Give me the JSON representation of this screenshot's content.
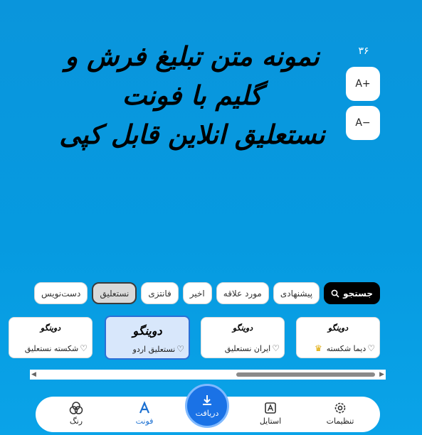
{
  "font_size": "۳۶",
  "size_buttons": {
    "increase": "A+",
    "decrease": "A−"
  },
  "preview": {
    "line1": "نمونه متن تبلیغ فرش و گلیم با فونت",
    "line2": "نستعلیق انلاین قابل کپی"
  },
  "filters": [
    {
      "label": "جستجو",
      "icon": "search-icon",
      "style": "search"
    },
    {
      "label": "پیشنهادی"
    },
    {
      "label": "مورد علاقه"
    },
    {
      "label": "اخیر"
    },
    {
      "label": "فانتزی"
    },
    {
      "label": "نستعلیق",
      "state": "active"
    },
    {
      "label": "دست‌نویس"
    }
  ],
  "font_cards": [
    {
      "glyph": "دوینگو",
      "name": "دیما شکسته",
      "badge": "crown-icon"
    },
    {
      "glyph": "دوینگو",
      "name": "ایران نستعلیق"
    },
    {
      "glyph": "دوینگو",
      "name": "نستعلیق اردو",
      "state": "selected"
    },
    {
      "glyph": "دوینگو",
      "name": "شکسته نستعلیق"
    }
  ],
  "bottom_nav": {
    "settings": {
      "label": "تنظیمات",
      "icon": "gear-icon"
    },
    "style": {
      "label": "استایل",
      "icon": "style-icon"
    },
    "download": {
      "label": "دریافت",
      "icon": "download-icon"
    },
    "font": {
      "label": "فونت",
      "icon": "font-icon",
      "state": "active"
    },
    "color": {
      "label": "رنگ",
      "icon": "palette-icon"
    }
  },
  "colors": {
    "background": "#0a95dc",
    "accent": "#1a72e6",
    "active_nav": "#1a6fd1",
    "selected_card": "#d8e7fb",
    "crown": "#e0a800"
  }
}
